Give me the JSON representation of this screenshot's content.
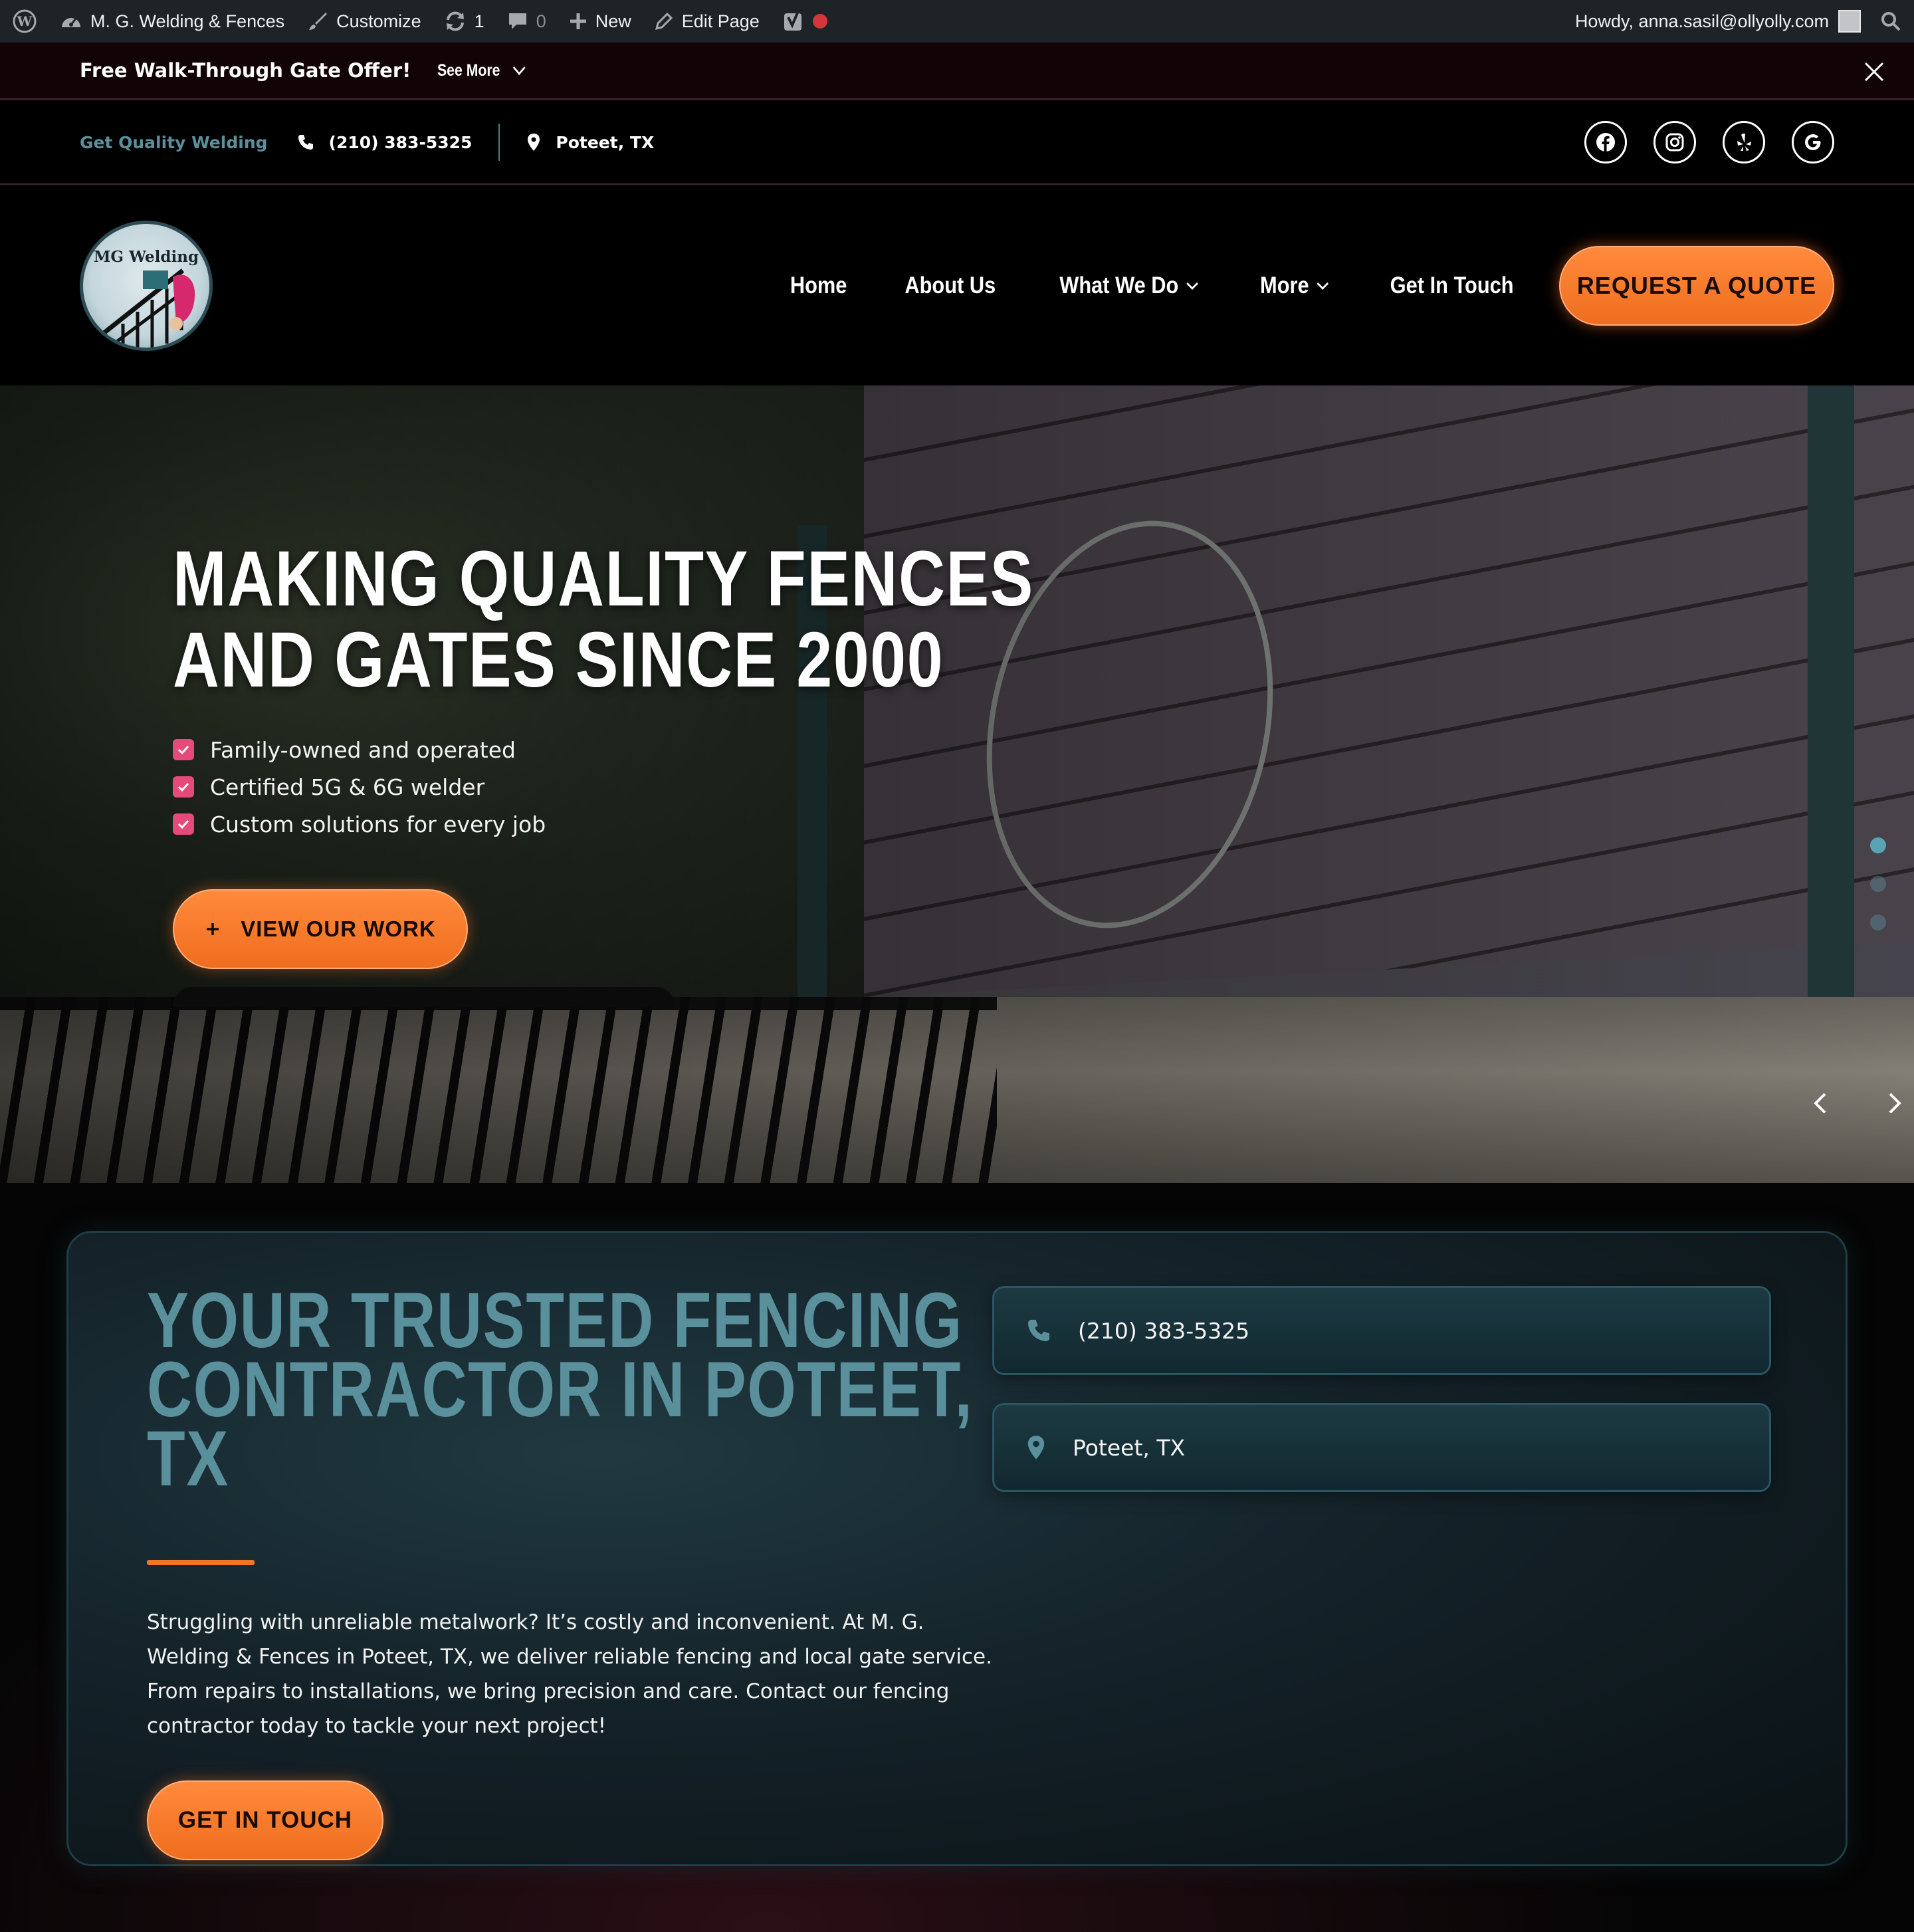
{
  "admin_bar": {
    "site_name": "M. G. Welding & Fences",
    "customize": "Customize",
    "updates_count": "1",
    "comments_count": "0",
    "new_label": "New",
    "edit_page": "Edit Page",
    "howdy": "Howdy, anna.sasil@ollyolly.com"
  },
  "promo": {
    "text": "Free Walk-Through Gate Offer!",
    "see_more": "See More"
  },
  "info_bar": {
    "tagline": "Get Quality Welding",
    "phone": "(210) 383-5325",
    "location": "Poteet, TX",
    "socials": [
      "facebook-icon",
      "instagram-icon",
      "yelp-icon",
      "google-icon"
    ]
  },
  "nav": {
    "logo_text": "MG Welding",
    "items": [
      {
        "label": "Home",
        "dropdown": false
      },
      {
        "label": "About Us",
        "dropdown": false
      },
      {
        "label": "What We Do",
        "dropdown": true
      },
      {
        "label": "More",
        "dropdown": true
      },
      {
        "label": "Get In Touch",
        "dropdown": false
      }
    ],
    "cta": "REQUEST A QUOTE"
  },
  "hero": {
    "title_line1": "MAKING QUALITY FENCES",
    "title_line2": "AND GATES SINCE 2000",
    "checks": [
      "Family-owned and operated",
      "Certified 5G & 6G welder",
      "Custom solutions for every job"
    ],
    "button": "VIEW OUR WORK",
    "slide_count": 3,
    "active_slide": 1
  },
  "trusted": {
    "title_line1": "YOUR TRUSTED FENCING",
    "title_line2": "CONTRACTOR IN POTEET,",
    "title_line3": "TX",
    "body": "Struggling with unreliable metalwork? It’s costly and inconvenient. At M. G. Welding & Fences in Poteet, TX, we deliver reliable fencing and local gate service. From repairs to installations, we bring precision and care. Contact our fencing contractor today to tackle your next project!",
    "button": "GET IN TOUCH",
    "phone": "(210) 383-5325",
    "location": "Poteet, TX"
  },
  "colors": {
    "accent_orange": "#f27427",
    "teal": "#5a8f9c",
    "check_pink": "#e64a7a",
    "admin_bar": "#1d2327"
  }
}
